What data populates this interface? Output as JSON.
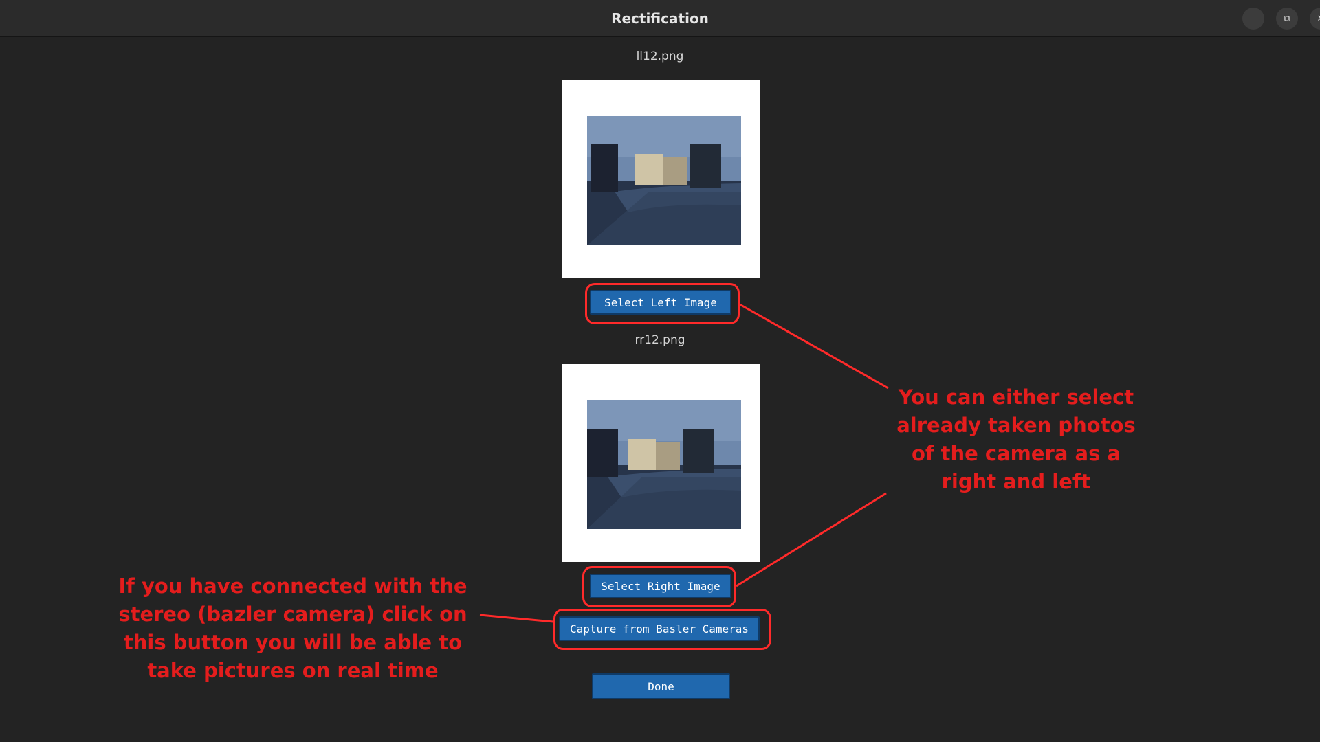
{
  "window": {
    "title": "Rectification",
    "controls": {
      "minimize": "–",
      "restore": "⧉",
      "close": "✕"
    }
  },
  "left_image": {
    "filename": "ll12.png",
    "button_label": "Select Left Image"
  },
  "right_image": {
    "filename": "rr12.png",
    "button_label": "Select Right Image"
  },
  "capture_button_label": "Capture from Basler Cameras",
  "done_button_label": "Done",
  "annotations": {
    "right_note": "You can either select already taken photos of the camera as a right and left",
    "left_note": "If you have connected with the stereo (bazler camera) click on this button you will be able to take pictures on real time"
  },
  "colors": {
    "background": "#232323",
    "button": "#2068ae",
    "annotation_red": "#e41d1d"
  }
}
